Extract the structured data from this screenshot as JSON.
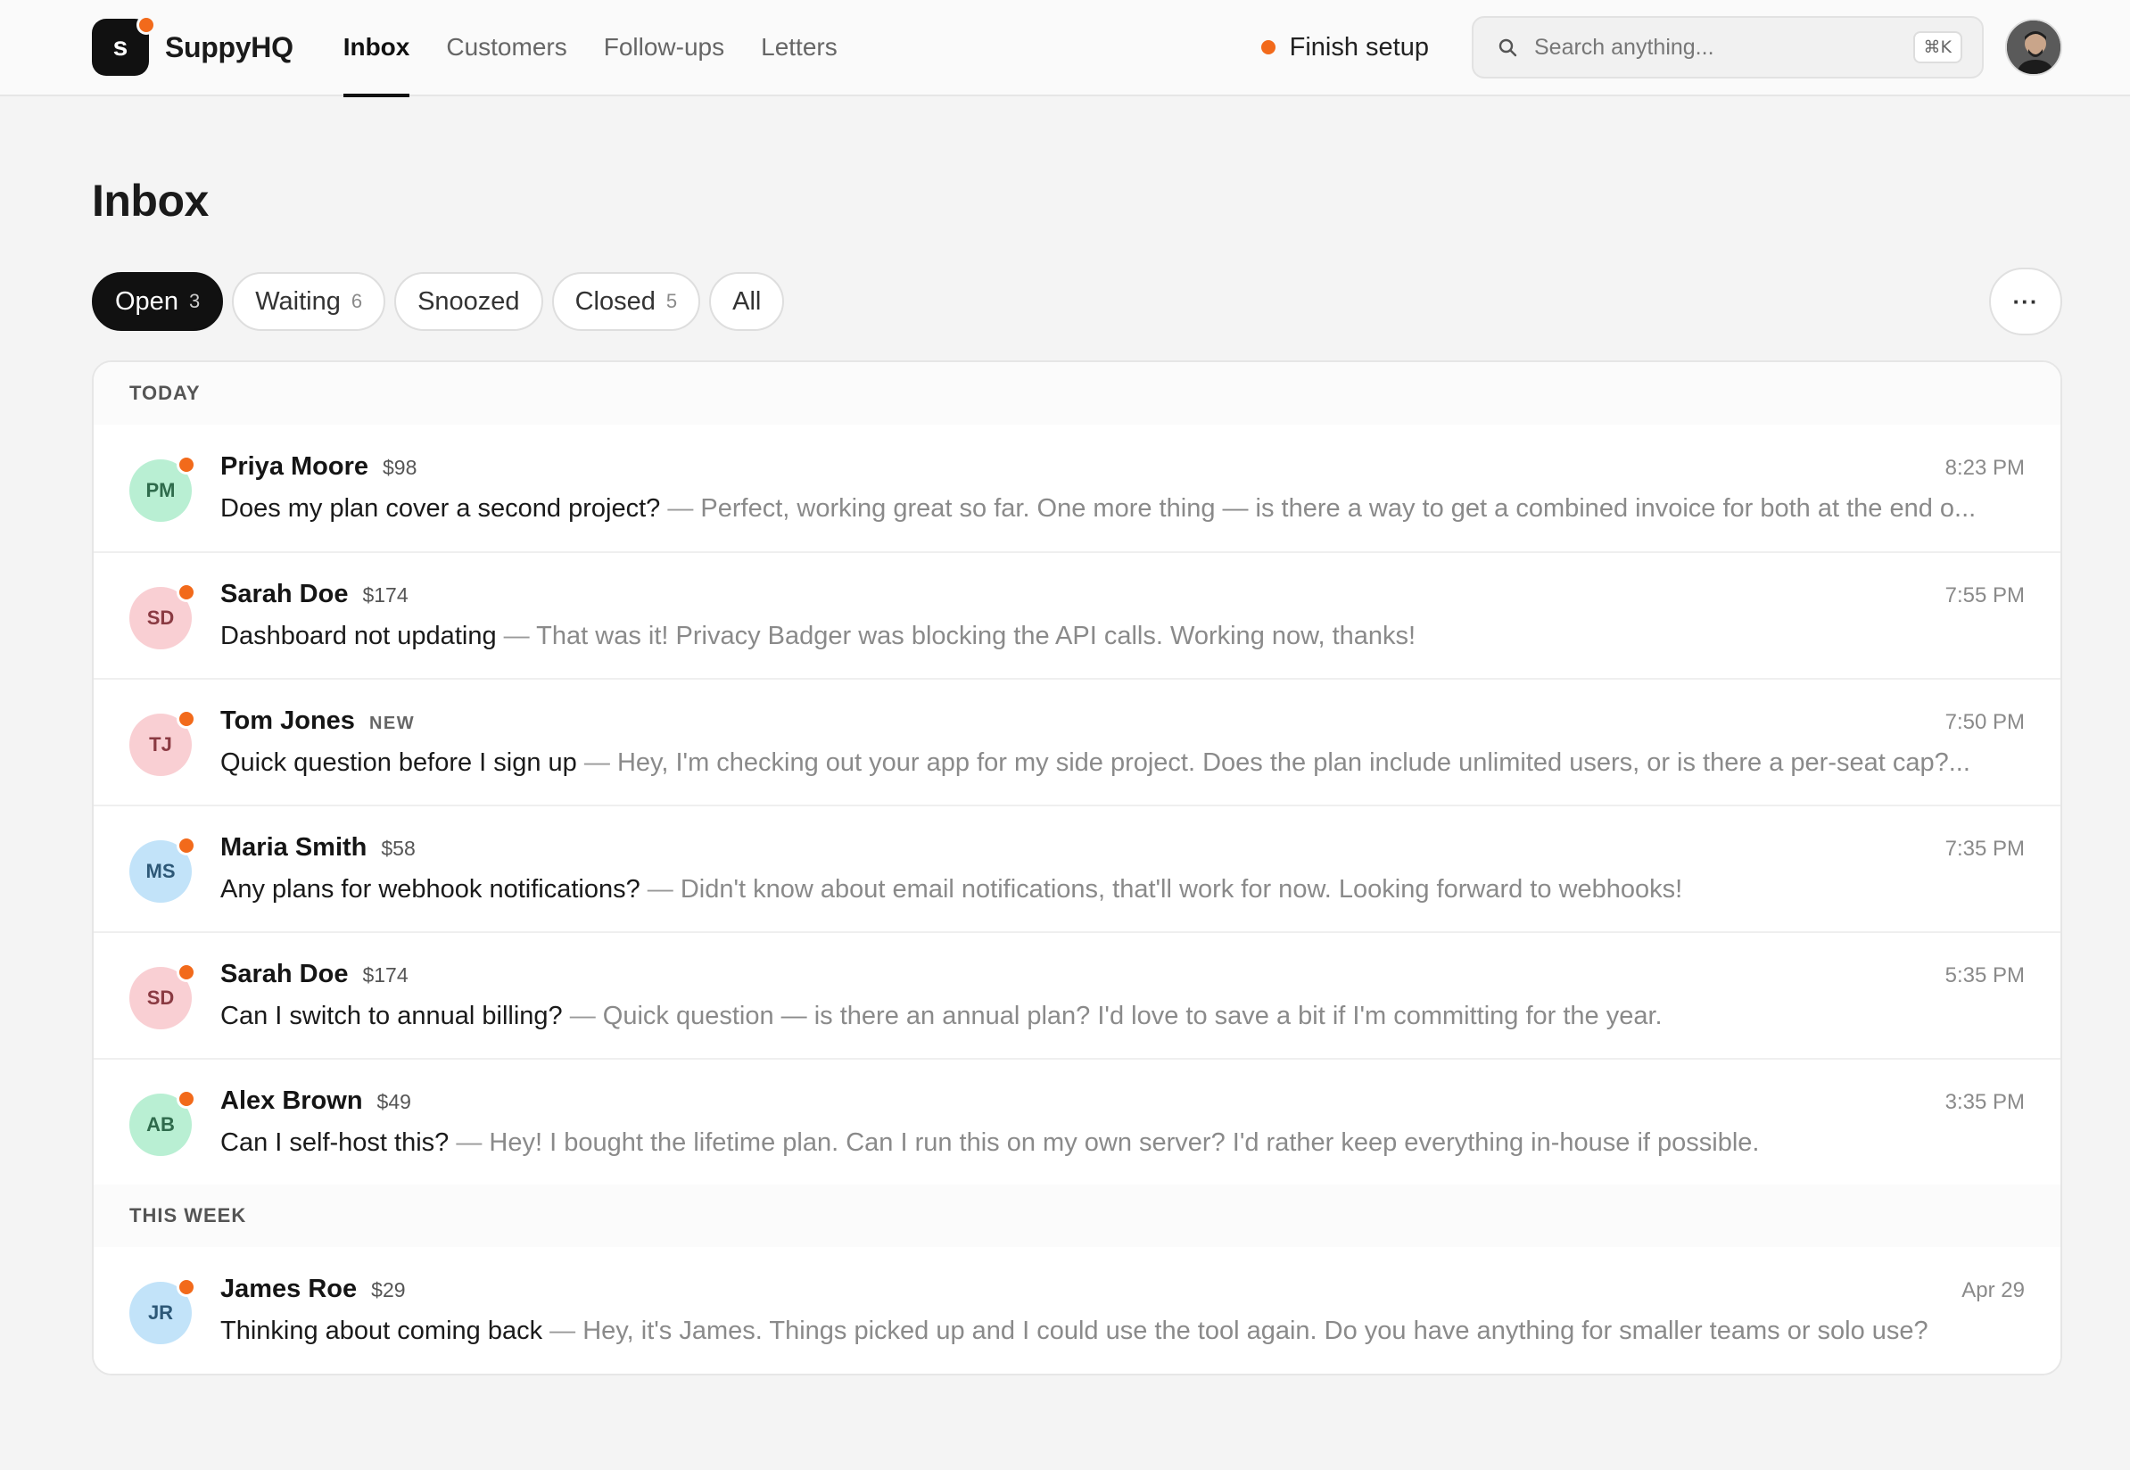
{
  "app": {
    "logo_letter": "s",
    "name": "SuppyHQ"
  },
  "nav": [
    {
      "label": "Inbox",
      "active": true
    },
    {
      "label": "Customers",
      "active": false
    },
    {
      "label": "Follow-ups",
      "active": false
    },
    {
      "label": "Letters",
      "active": false
    }
  ],
  "header": {
    "finish_setup": "Finish setup",
    "search_placeholder": "Search anything...",
    "search_shortcut": "⌘K"
  },
  "page": {
    "title": "Inbox"
  },
  "filters": [
    {
      "label": "Open",
      "count": "3",
      "active": true
    },
    {
      "label": "Waiting",
      "count": "6",
      "active": false
    },
    {
      "label": "Snoozed",
      "count": "",
      "active": false
    },
    {
      "label": "Closed",
      "count": "5",
      "active": false
    },
    {
      "label": "All",
      "count": "",
      "active": false
    }
  ],
  "more_label": "···",
  "sections": [
    {
      "title": "TODAY",
      "rows": [
        {
          "initials": "PM",
          "avatar_bg": "#b9efd3",
          "avatar_fg": "#2f6b4c",
          "name": "Priya Moore",
          "amount": "$98",
          "badge": "",
          "time": "8:23 PM",
          "subject": "Does my plan cover a second project?",
          "preview": "Perfect, working great so far. One more thing — is there a way to get a combined invoice for both at the end o..."
        },
        {
          "initials": "SD",
          "avatar_bg": "#f9cfd3",
          "avatar_fg": "#8a3a42",
          "name": "Sarah Doe",
          "amount": "$174",
          "badge": "",
          "time": "7:55 PM",
          "subject": "Dashboard not updating",
          "preview": "That was it! Privacy Badger was blocking the API calls. Working now, thanks!"
        },
        {
          "initials": "TJ",
          "avatar_bg": "#f9cfd3",
          "avatar_fg": "#8a3a42",
          "name": "Tom Jones",
          "amount": "",
          "badge": "NEW",
          "time": "7:50 PM",
          "subject": "Quick question before I sign up",
          "preview": "Hey, I'm checking out your app for my side project. Does the plan include unlimited users, or is there a per-seat cap?..."
        },
        {
          "initials": "MS",
          "avatar_bg": "#c2e3f9",
          "avatar_fg": "#2d5877",
          "name": "Maria Smith",
          "amount": "$58",
          "badge": "",
          "time": "7:35 PM",
          "subject": "Any plans for webhook notifications?",
          "preview": "Didn't know about email notifications, that'll work for now. Looking forward to webhooks!"
        },
        {
          "initials": "SD",
          "avatar_bg": "#f9cfd3",
          "avatar_fg": "#8a3a42",
          "name": "Sarah Doe",
          "amount": "$174",
          "badge": "",
          "time": "5:35 PM",
          "subject": "Can I switch to annual billing?",
          "preview": "Quick question — is there an annual plan? I'd love to save a bit if I'm committing for the year."
        },
        {
          "initials": "AB",
          "avatar_bg": "#b9efd3",
          "avatar_fg": "#2f6b4c",
          "name": "Alex Brown",
          "amount": "$49",
          "badge": "",
          "time": "3:35 PM",
          "subject": "Can I self-host this?",
          "preview": "Hey! I bought the lifetime plan. Can I run this on my own server? I'd rather keep everything in-house if possible."
        }
      ]
    },
    {
      "title": "THIS WEEK",
      "rows": [
        {
          "initials": "JR",
          "avatar_bg": "#c2e3f9",
          "avatar_fg": "#2d5877",
          "name": "James Roe",
          "amount": "$29",
          "badge": "",
          "time": "Apr 29",
          "subject": "Thinking about coming back",
          "preview": "Hey, it's James. Things picked up and I could use the tool again. Do you have anything for smaller teams or solo use?"
        }
      ]
    }
  ],
  "separator": " — ",
  "colors": {
    "accent": "#f26a1b",
    "primary": "#111111"
  }
}
